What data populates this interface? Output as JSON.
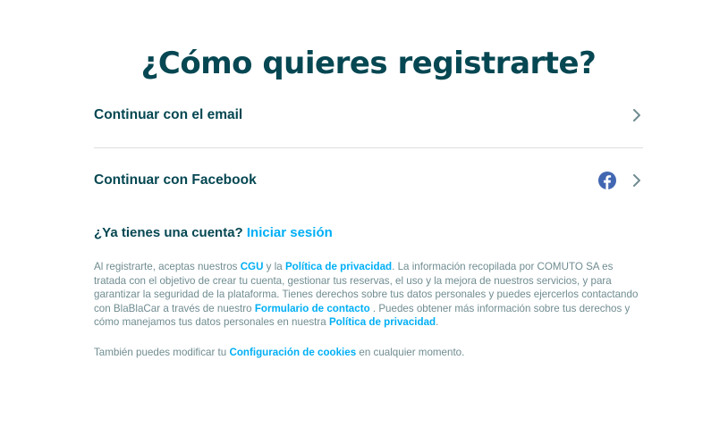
{
  "title": "¿Cómo quieres registrarte?",
  "options": [
    {
      "label": "Continuar con el email",
      "icon": "chevron-right-icon"
    },
    {
      "label": "Continuar con Facebook",
      "icon": "facebook-icon"
    }
  ],
  "account": {
    "question": "¿Ya tienes una cuenta?",
    "login_link": "Iniciar sesión"
  },
  "legal": {
    "p1": "Al registrarte, aceptas nuestros ",
    "cgu_link": "CGU",
    "p2": " y la ",
    "privacy_link_1": "Política de privacidad",
    "p3": ". La información recopilada por COMUTO SA es tratada con el objetivo de crear tu cuenta, gestionar tus reservas, el uso y la mejora de nuestros servicios, y para garantizar la seguridad de la plataforma. Tienes derechos sobre tus datos personales y puedes ejercerlos contactando con BlaBlaCar a través de nuestro ",
    "contact_link": "Formulario de contacto",
    "p4": " . Puedes obtener más información sobre tus derechos y cómo manejamos tus datos personales en nuestra ",
    "privacy_link_2": "Política de privacidad",
    "p5": "."
  },
  "cookies": {
    "p1": "También puedes modificar tu ",
    "link": "Configuración de cookies",
    "p2": " en cualquier momento."
  },
  "colors": {
    "heading": "#054752",
    "link": "#00aff5",
    "body_text": "#708c91",
    "divider": "#dddddd",
    "facebook": "#4267b2"
  }
}
